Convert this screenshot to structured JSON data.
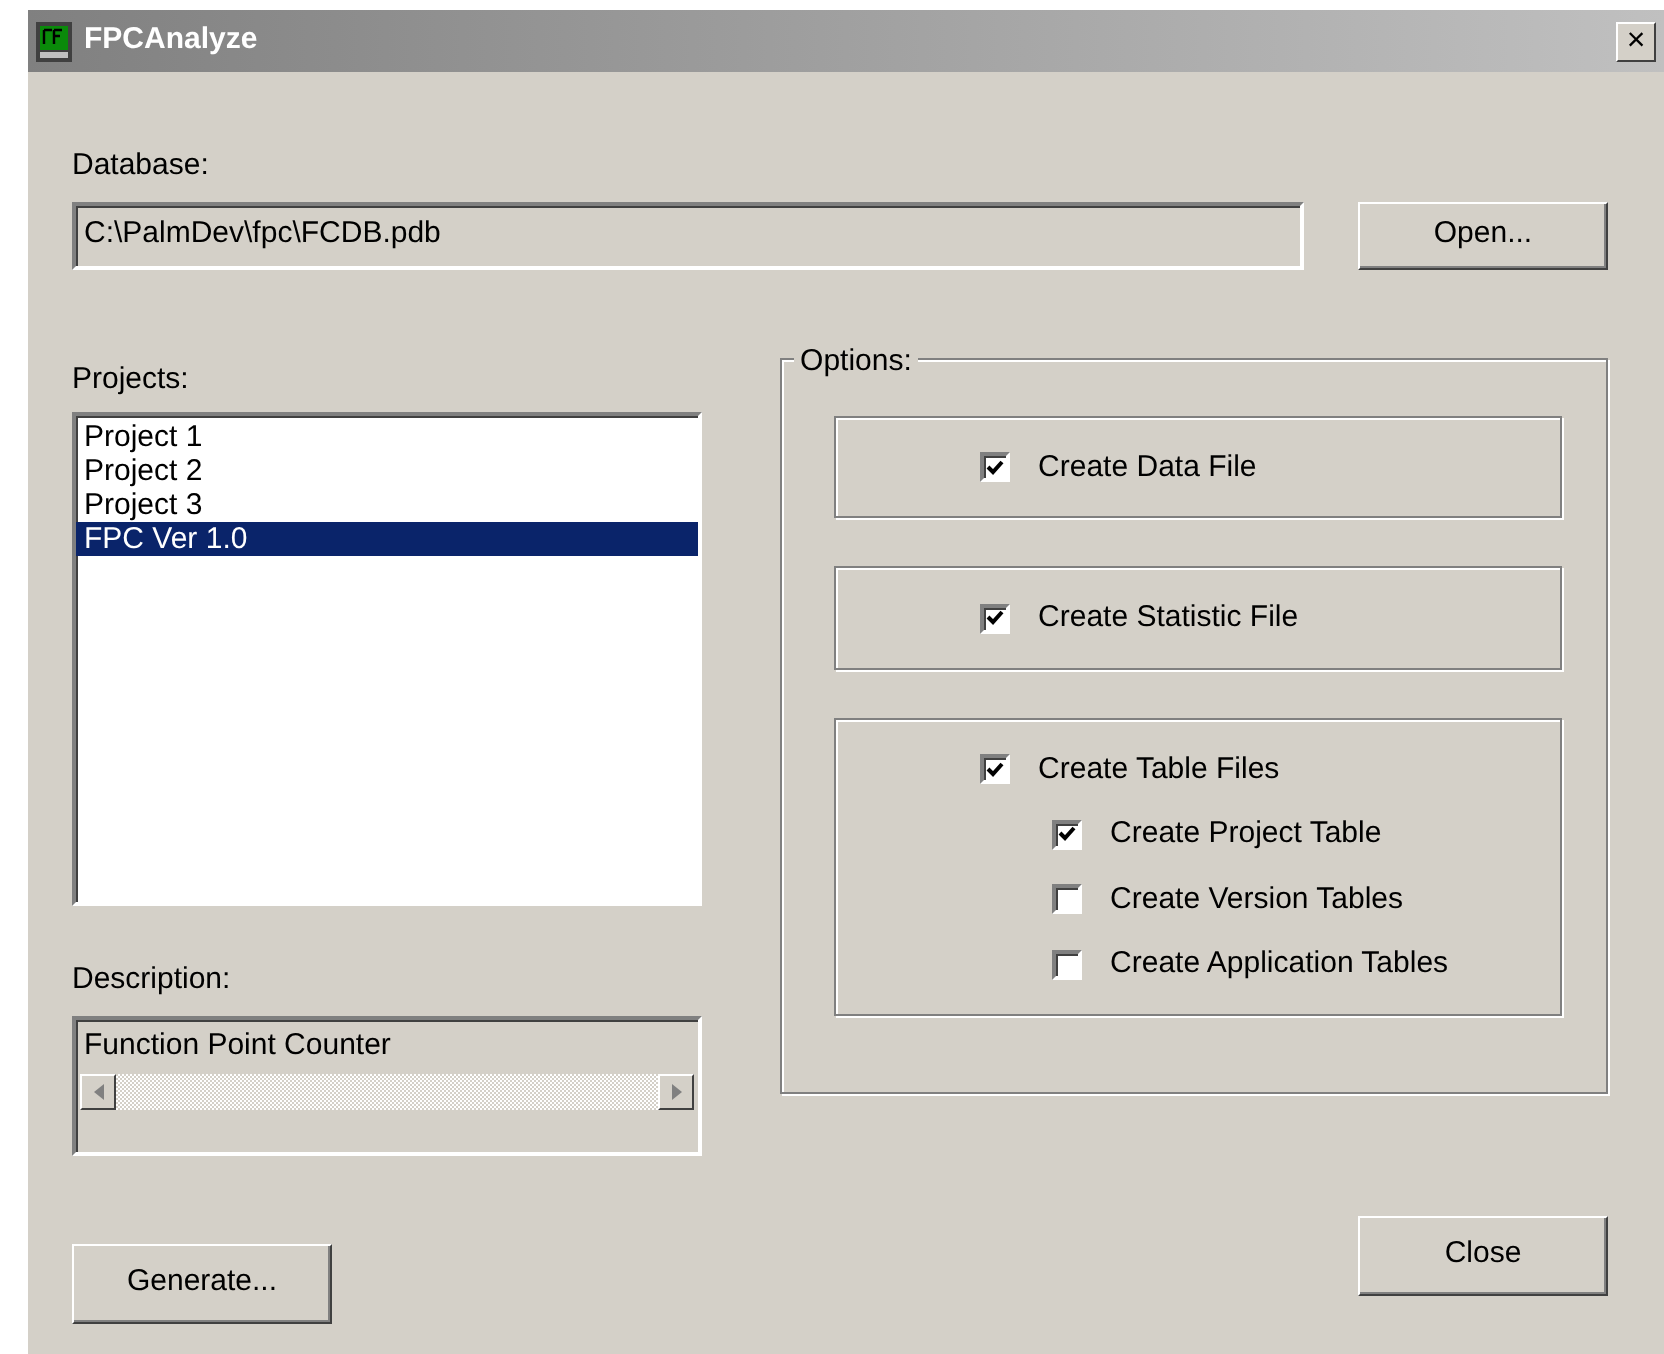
{
  "window": {
    "title": "FPCAnalyze",
    "close": "×"
  },
  "database": {
    "label": "Database:",
    "value": "C:\\PalmDev\\fpc\\FCDB.pdb"
  },
  "open_button": "Open...",
  "projects": {
    "label": "Projects:",
    "items": [
      {
        "label": "Project 1",
        "selected": false
      },
      {
        "label": "Project 2",
        "selected": false
      },
      {
        "label": "Project 3",
        "selected": false
      },
      {
        "label": "FPC Ver 1.0",
        "selected": true
      }
    ]
  },
  "description": {
    "label": "Description:",
    "value": "Function Point Counter"
  },
  "options": {
    "label": "Options:",
    "groups": [
      {
        "items": [
          {
            "label": "Create Data File",
            "checked": true
          }
        ]
      },
      {
        "items": [
          {
            "label": "Create Statistic File",
            "checked": true
          }
        ]
      },
      {
        "items": [
          {
            "label": "Create Table Files",
            "checked": true,
            "children": [
              {
                "label": "Create Project Table",
                "checked": true
              },
              {
                "label": "Create Version Tables",
                "checked": false
              },
              {
                "label": "Create Application Tables",
                "checked": false
              }
            ]
          }
        ]
      }
    ]
  },
  "generate_button": "Generate...",
  "close_button": "Close"
}
